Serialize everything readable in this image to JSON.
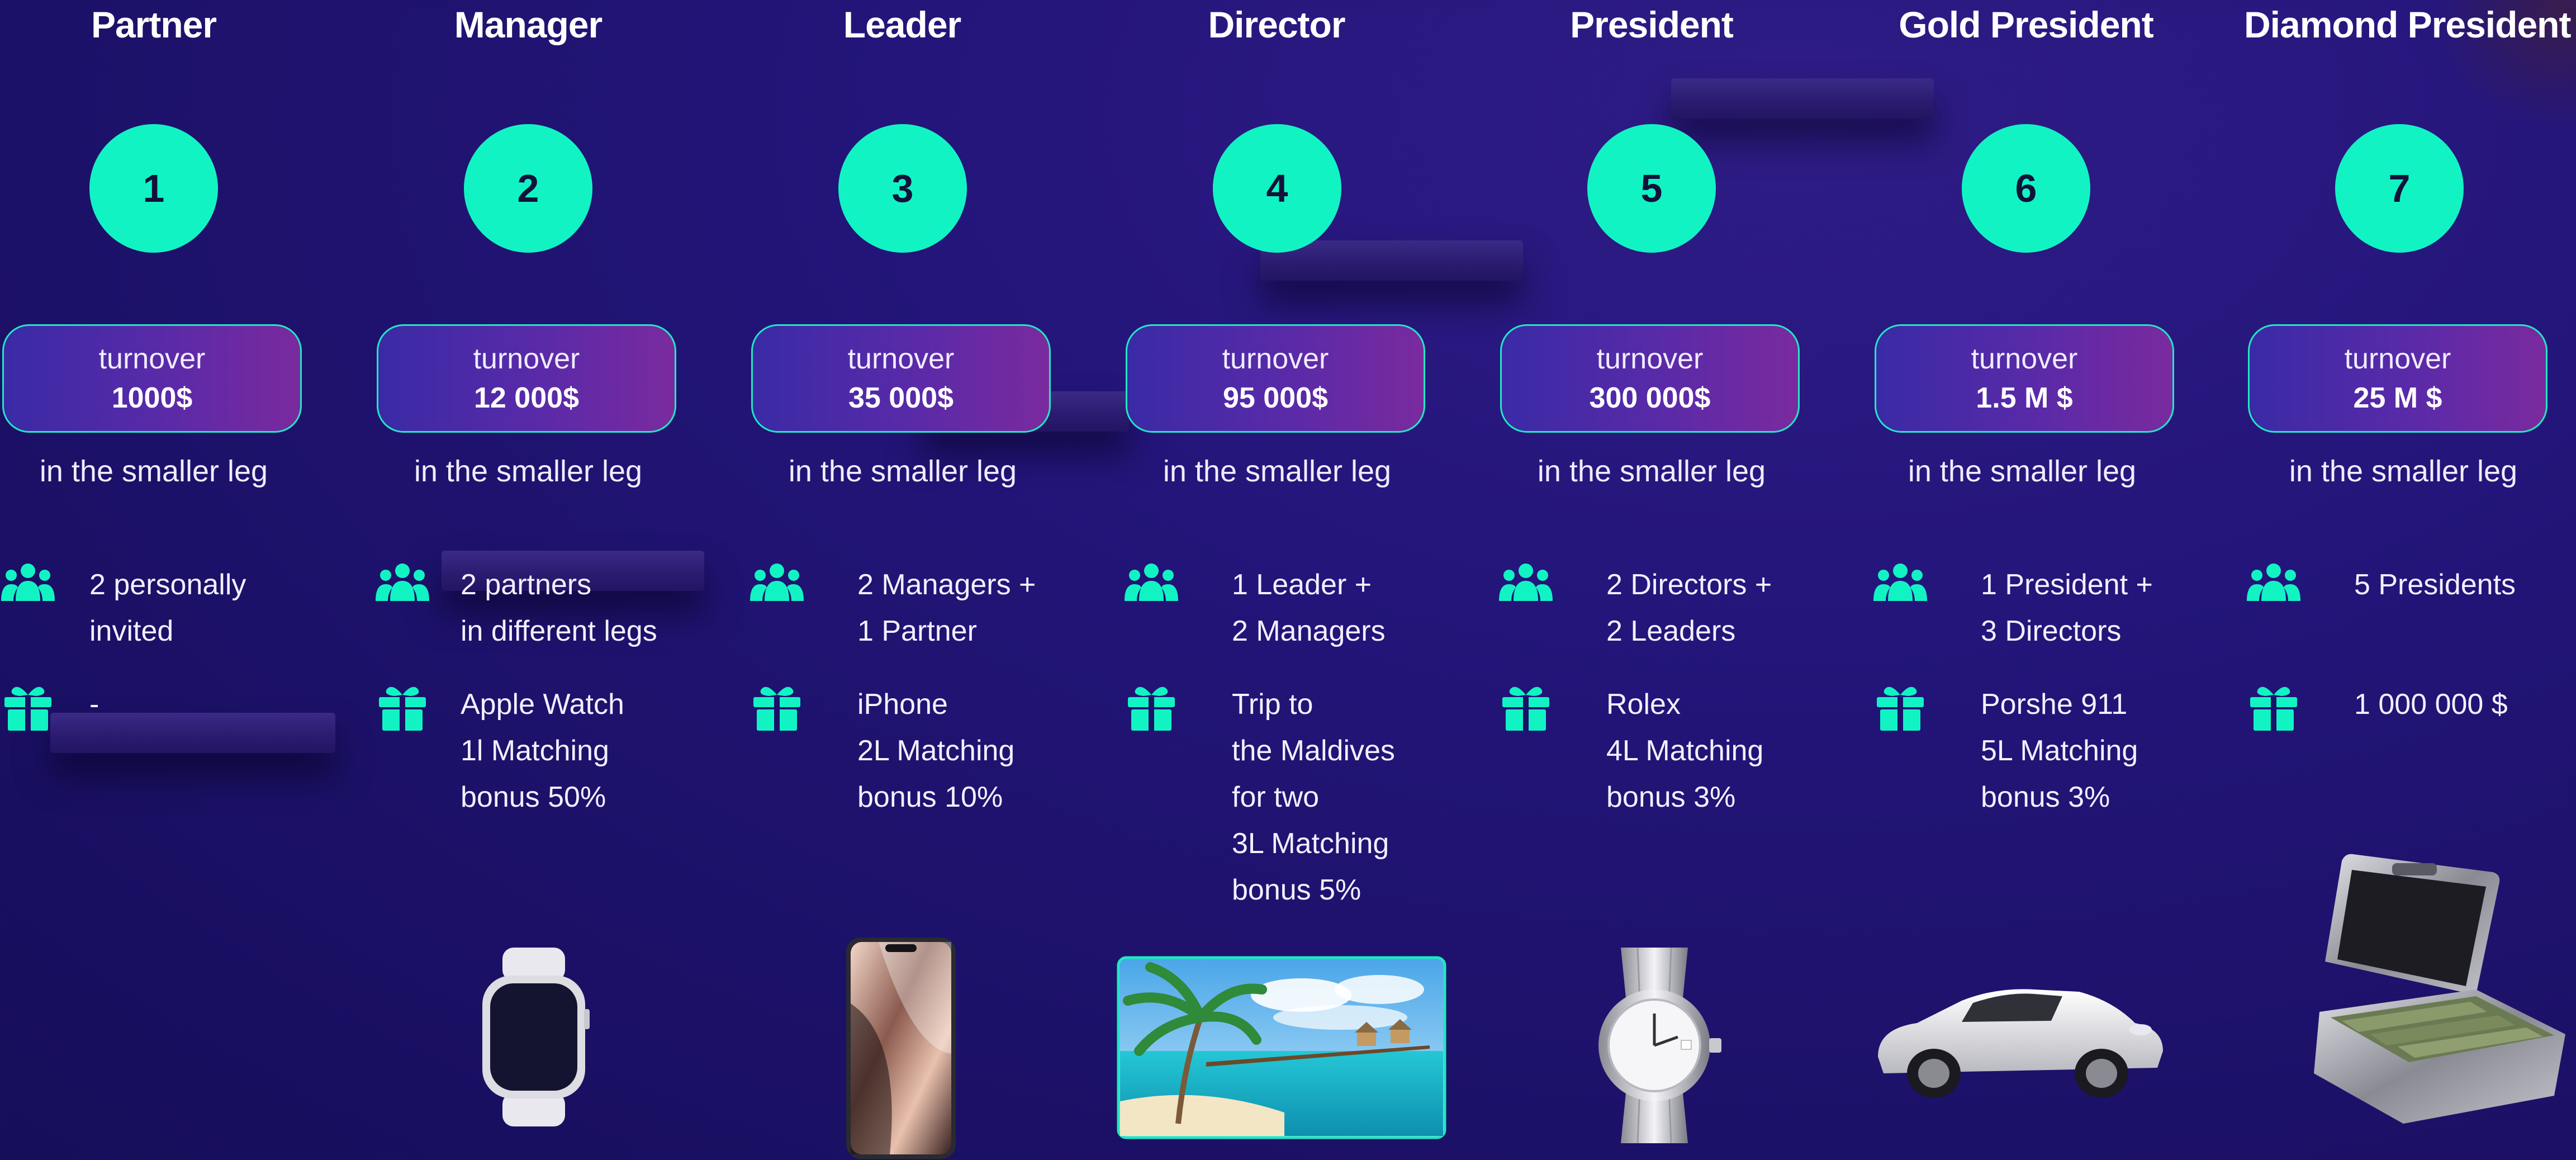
{
  "theme": {
    "accent": "#12f3c4",
    "background": "#1c1168",
    "pill_border": "#22e6c4"
  },
  "icons": {
    "requirement": "people-group-icon",
    "reward": "gift-icon"
  },
  "ranks": [
    {
      "title": "Partner",
      "number": "1",
      "turnover_label": "turnover",
      "turnover": "1000$",
      "leg_note": "in the smaller leg",
      "requirement": "2 personally\ninvited",
      "reward": "-"
    },
    {
      "title": "Manager",
      "number": "2",
      "turnover_label": "turnover",
      "turnover": "12 000$",
      "leg_note": "in the smaller leg",
      "requirement": "2 partners\nin different legs",
      "reward": "Apple Watch\n1l Matching\nbonus 50%"
    },
    {
      "title": "Leader",
      "number": "3",
      "turnover_label": "turnover",
      "turnover": "35 000$",
      "leg_note": "in the smaller leg",
      "requirement": "2 Managers +\n1 Partner",
      "reward": "iPhone\n2L Matching\nbonus 10%"
    },
    {
      "title": "Director",
      "number": "4",
      "turnover_label": "turnover",
      "turnover": "95 000$",
      "leg_note": "in the smaller leg",
      "requirement": "1 Leader +\n2 Managers",
      "reward": "Trip to\nthe Maldives\nfor two\n3L Matching\nbonus 5%"
    },
    {
      "title": "President",
      "number": "5",
      "turnover_label": "turnover",
      "turnover": "300 000$",
      "leg_note": "in the smaller leg",
      "requirement": "2 Directors +\n2 Leaders",
      "reward": "Rolex\n4L Matching\n bonus 3%"
    },
    {
      "title": "Gold President",
      "number": "6",
      "turnover_label": "turnover",
      "turnover": "1.5 M $",
      "leg_note": "in the smaller leg",
      "requirement": "1 President +\n3 Directors",
      "reward": "Porshe 911\n5L Matching\n bonus 3%"
    },
    {
      "title": "Diamond President",
      "number": "7",
      "turnover_label": "turnover",
      "turnover": "25 M $",
      "leg_note": "in the smaller leg",
      "requirement": "5 Presidents",
      "reward": "1 000 000 $"
    }
  ]
}
